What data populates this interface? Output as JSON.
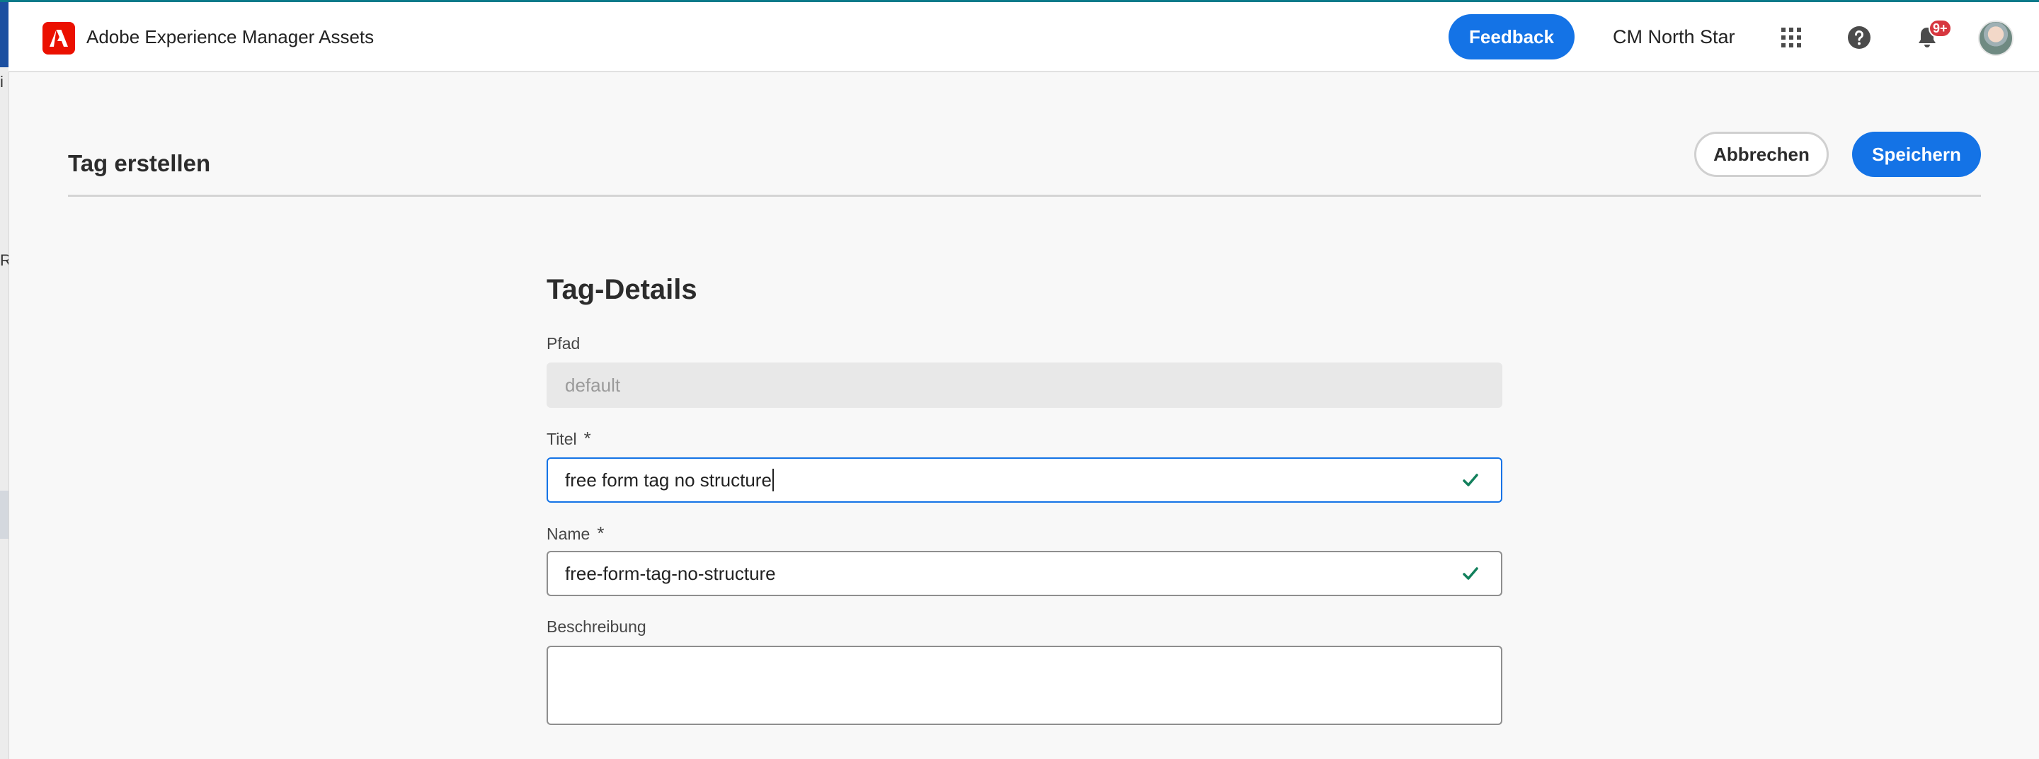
{
  "shell": {
    "app_name": "Adobe Experience Manager Assets",
    "feedback_label": "Feedback",
    "org_name": "CM North Star",
    "notification_count": "9+",
    "accent_color": "#1473e6",
    "logo_color": "#eb1000",
    "icons": [
      "apps-grid-icon",
      "help-icon",
      "bell-icon"
    ]
  },
  "background_strip": {
    "glyphs": [
      "i",
      "R"
    ]
  },
  "page": {
    "title": "Tag erstellen",
    "cancel_label": "Abbrechen",
    "save_label": "Speichern"
  },
  "form": {
    "section_title": "Tag-Details",
    "path": {
      "label": "Pfad",
      "value": "default"
    },
    "title": {
      "label": "Titel",
      "required_mark": "*",
      "value": "free form tag no structure",
      "valid": true
    },
    "name": {
      "label": "Name",
      "required_mark": "*",
      "value": "free-form-tag-no-structure",
      "valid": true
    },
    "description": {
      "label": "Beschreibung",
      "value": ""
    }
  }
}
